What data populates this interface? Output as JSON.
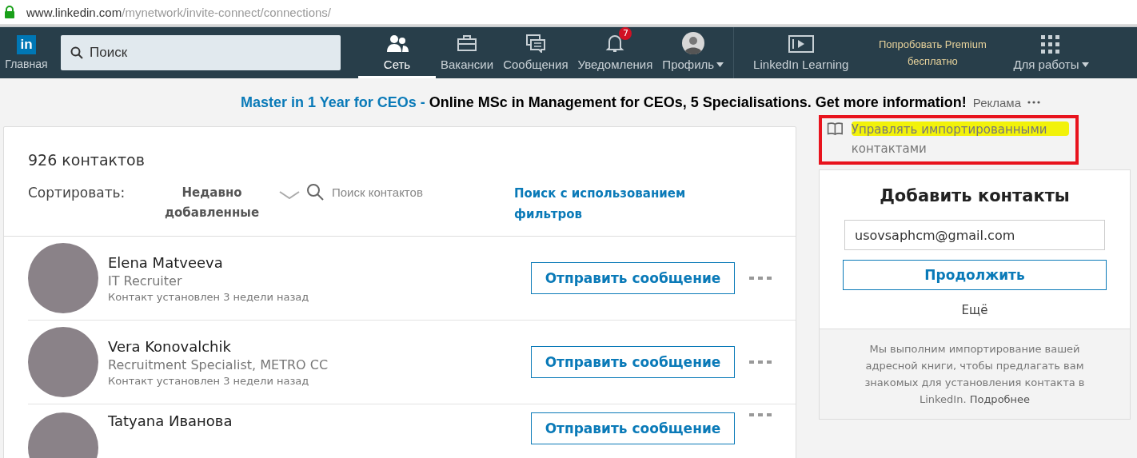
{
  "address_bar": {
    "host": "www.linkedin.com",
    "path": "/mynetwork/invite-connect/connections/"
  },
  "nav": {
    "home_label": "Главная",
    "logo": "in",
    "search": {
      "placeholder": "Поиск"
    },
    "items": [
      {
        "kind": "people",
        "label": "Сеть",
        "selected": true
      },
      {
        "kind": "briefcase",
        "label": "Вакансии",
        "selected": false
      },
      {
        "kind": "messages",
        "label": "Сообщения",
        "selected": false
      },
      {
        "kind": "bell",
        "label": "Уведомления",
        "selected": false,
        "badge": "7"
      },
      {
        "kind": "avatar",
        "label": "Профиль",
        "selected": false
      }
    ],
    "learning": {
      "label": "LinkedIn Learning"
    },
    "premium": [
      "Попробовать Premium",
      "бесплатно"
    ],
    "work": {
      "label": "Для работы"
    }
  },
  "ad": {
    "link": "Master in 1 Year for CEOs -",
    "text": "Online MSc in Management for CEOs, 5 Specialisations. Get more information!",
    "label": "Реклама"
  },
  "connections": {
    "count": "926 контактов",
    "sort_label": "Сортировать:",
    "sort_value": "Недавно добавленные",
    "search": {
      "placeholder": "Поиск контактов"
    },
    "filter_link": "Поиск с использованием фильтров",
    "rows": [
      {
        "name": "Elena Matveeva",
        "headline": "IT Recruiter",
        "time": "Контакт установлен 3 недели назад",
        "button": "Отправить сообщение"
      },
      {
        "name": "Vera Konovalchik",
        "headline": "Recruitment Specialist, METRO CC",
        "time": "Контакт установлен 3 недели назад",
        "button": "Отправить сообщение"
      },
      {
        "name": "Tatyana Иванова",
        "button": "Отправить сообщение"
      }
    ]
  },
  "sidebar": {
    "manage_link": "Управлять импортированными контактами",
    "add": {
      "title": "Добавить контакты",
      "email": "usovsaphcm@gmail.com",
      "button": "Продолжить",
      "more": "Ещё",
      "note": "Мы выполним импортирование вашей адресной книги, чтобы предлагать вам знакомых для установления контакта в LinkedIn.",
      "note_link": "Подробнее"
    }
  }
}
